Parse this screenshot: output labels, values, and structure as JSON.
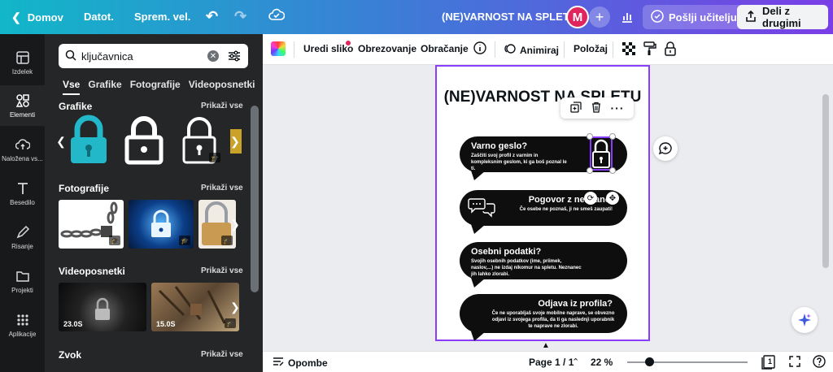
{
  "topbar": {
    "home": "Domov",
    "file": "Datot.",
    "resize": "Sprem. vel.",
    "title": "(NE)VARNOST NA SPLETU",
    "avatar_initial": "M",
    "send_teacher": "Pošlji učitelju",
    "share": "Deli z drugimi"
  },
  "rail": {
    "items": [
      {
        "label": "Izdelek",
        "icon": "layout-icon"
      },
      {
        "label": "Elementi",
        "icon": "shapes-icon"
      },
      {
        "label": "Naložena vs...",
        "icon": "upload-cloud-icon"
      },
      {
        "label": "Besedilo",
        "icon": "text-icon"
      },
      {
        "label": "Risanje",
        "icon": "pen-icon"
      },
      {
        "label": "Projekti",
        "icon": "folder-icon"
      },
      {
        "label": "Aplikacije",
        "icon": "apps-grid-icon"
      }
    ]
  },
  "panel": {
    "search_value": "ključavnica",
    "tabs": [
      "Vse",
      "Grafike",
      "Fotografije",
      "Videoposnetki"
    ],
    "sections": {
      "graphics": {
        "title": "Grafike",
        "more": "Prikaži vse"
      },
      "photos": {
        "title": "Fotografije",
        "more": "Prikaži vse"
      },
      "videos": {
        "title": "Videoposnetki",
        "more": "Prikaži vse",
        "durations": [
          "23.0S",
          "15.0S"
        ]
      },
      "audio": {
        "title": "Zvok",
        "more": "Prikaži vse"
      }
    }
  },
  "toolbar": {
    "edit_image": "Uredi sliko",
    "crop": "Obrezovanje",
    "flip": "Obračanje",
    "animate": "Animiraj",
    "position": "Položaj"
  },
  "design": {
    "title": "(NE)VARNOST NA SPLETU",
    "bubbles": [
      {
        "title": "Varno geslo?",
        "text": "Zaščiti svoj profil z varnim in kompleksnim geslom, ki ga boš poznal le ti."
      },
      {
        "title": "Pogovor z neznanci",
        "text": "Če osebe ne poznaš, ji ne smeš zaupati!"
      },
      {
        "title": "Osebni podatki?",
        "text": "Svojih osebnih podatkov (ime, priimek, naslov,...) ne izdaj nikomur na spletu. Neznanec jih lahko zlorabi."
      },
      {
        "title": "Odjava iz profila?",
        "text": "Če ne uporabljaš svoje mobilne naprave, se obvezno odjavi iz svojega profila, da ti ga naslednji uporabnik te naprave ne zlorabi."
      }
    ]
  },
  "bottombar": {
    "notes": "Opombe",
    "page": "Page 1 / 1",
    "zoom": "22 %",
    "page_count": "1"
  },
  "colors": {
    "accent": "#8b3dff",
    "avatar": "#e0245e",
    "lock_teal": "#22b8c9"
  }
}
